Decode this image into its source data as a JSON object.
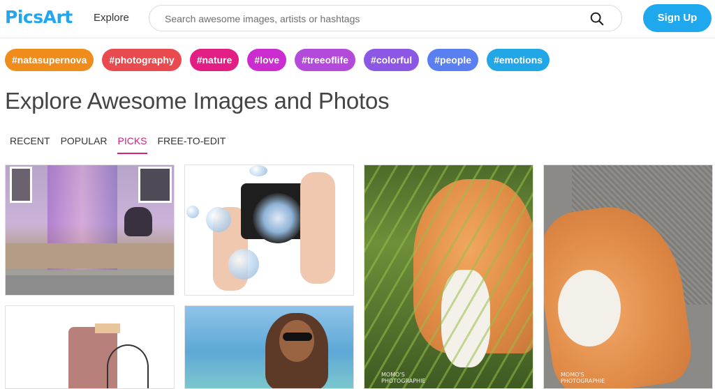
{
  "header": {
    "logo": "PicsArt",
    "nav_explore": "Explore",
    "search_placeholder": "Search awesome images, artists or hashtags",
    "signup_label": "Sign Up"
  },
  "tags": [
    {
      "label": "#natasupernova",
      "color": "#f08c1b"
    },
    {
      "label": "#photography",
      "color": "#e94a4d"
    },
    {
      "label": "#nature",
      "color": "#e21e85"
    },
    {
      "label": "#love",
      "color": "#cb2ccf"
    },
    {
      "label": "#treeoflife",
      "color": "#b44ad9"
    },
    {
      "label": "#colorful",
      "color": "#8c57e5"
    },
    {
      "label": "#people",
      "color": "#5a7ff0"
    },
    {
      "label": "#emotions",
      "color": "#22a7e6"
    }
  ],
  "page_title": "Explore Awesome Images and Photos",
  "tabs": {
    "recent": "RECENT",
    "popular": "POPULAR",
    "picks": "PICKS",
    "free_to_edit": "FREE-TO-EDIT",
    "active": "PICKS"
  },
  "gallery": {
    "watermark_line1": "MOMO'S",
    "watermark_line2": "PHOTOGRAPHIE"
  }
}
